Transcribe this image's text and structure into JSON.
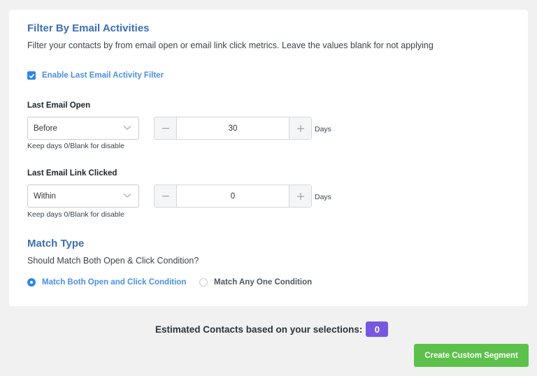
{
  "filter": {
    "title": "Filter By Email Activities",
    "description": "Filter your contacts by from email open or email link click metrics. Leave the values blank for not applying",
    "enable_label": "Enable Last Email Activity Filter",
    "enable_checked": true,
    "last_open": {
      "label": "Last Email Open",
      "select_value": "Before",
      "days_value": "30",
      "unit": "Days",
      "hint": "Keep days 0/Blank for disable"
    },
    "last_click": {
      "label": "Last Email Link Clicked",
      "select_value": "Within",
      "days_value": "0",
      "unit": "Days",
      "hint": "Keep days 0/Blank for disable"
    }
  },
  "match": {
    "title": "Match Type",
    "question": "Should Match Both Open & Click Condition?",
    "options": [
      {
        "label": "Match Both Open and Click Condition",
        "selected": true
      },
      {
        "label": "Match Any One Condition",
        "selected": false
      }
    ]
  },
  "footer": {
    "estimate_label": "Estimated Contacts based on your selections:",
    "estimate_count": "0",
    "create_button": "Create Custom Segment"
  },
  "colors": {
    "accent": "#2e87e6",
    "title": "#3c6fb4",
    "badge": "#7657e0",
    "create": "#5cc14a"
  }
}
